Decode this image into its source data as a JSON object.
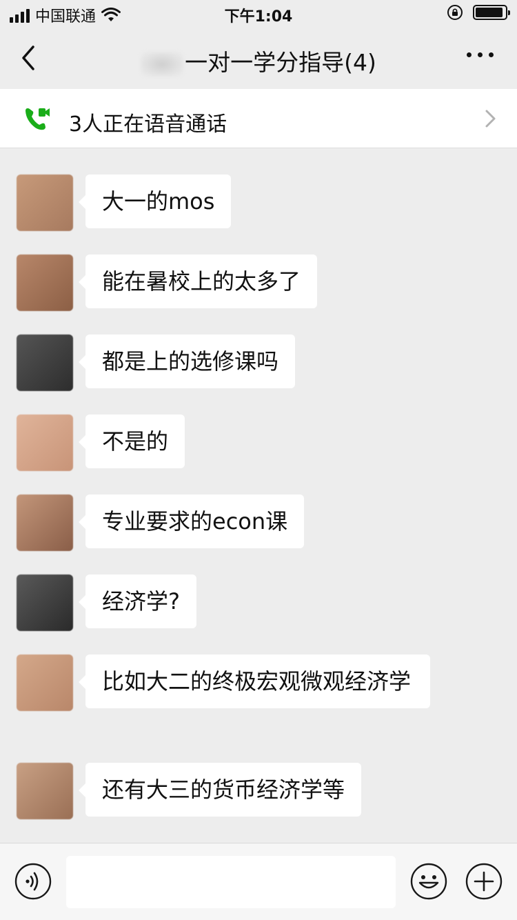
{
  "status_bar": {
    "carrier": "中国联通",
    "time": "下午1:04",
    "battery_level": 0.92
  },
  "nav": {
    "title": "一对一学分指导(4)"
  },
  "call_banner": {
    "text": "3人正在语音通话"
  },
  "messages": [
    {
      "text": "大一的mos",
      "avatar_colors": [
        "#c79a7a",
        "#a77a5f"
      ]
    },
    {
      "text": "能在暑校上的太多了",
      "avatar_colors": [
        "#b8876a",
        "#8c5f45"
      ]
    },
    {
      "text": "都是上的选修课吗",
      "avatar_colors": [
        "#555555",
        "#2d2d2d"
      ]
    },
    {
      "text": "不是的",
      "avatar_colors": [
        "#e0b49a",
        "#c89478"
      ]
    },
    {
      "text": "专业要求的econ课",
      "avatar_colors": [
        "#c3967a",
        "#8a5e48"
      ]
    },
    {
      "text": "经济学?",
      "avatar_colors": [
        "#5a5a5a",
        "#2a2a2a"
      ]
    },
    {
      "text": "比如大二的终极宏观微观经济学",
      "avatar_colors": [
        "#d4a88a",
        "#b9876a"
      ]
    },
    {
      "text": "还有大三的货币经济学等",
      "avatar_colors": [
        "#c8a084",
        "#9a6f55"
      ]
    }
  ],
  "input": {
    "value": "",
    "placeholder": ""
  },
  "colors": {
    "background": "#ededed",
    "bubble": "#ffffff",
    "call_green": "#1aad19"
  }
}
